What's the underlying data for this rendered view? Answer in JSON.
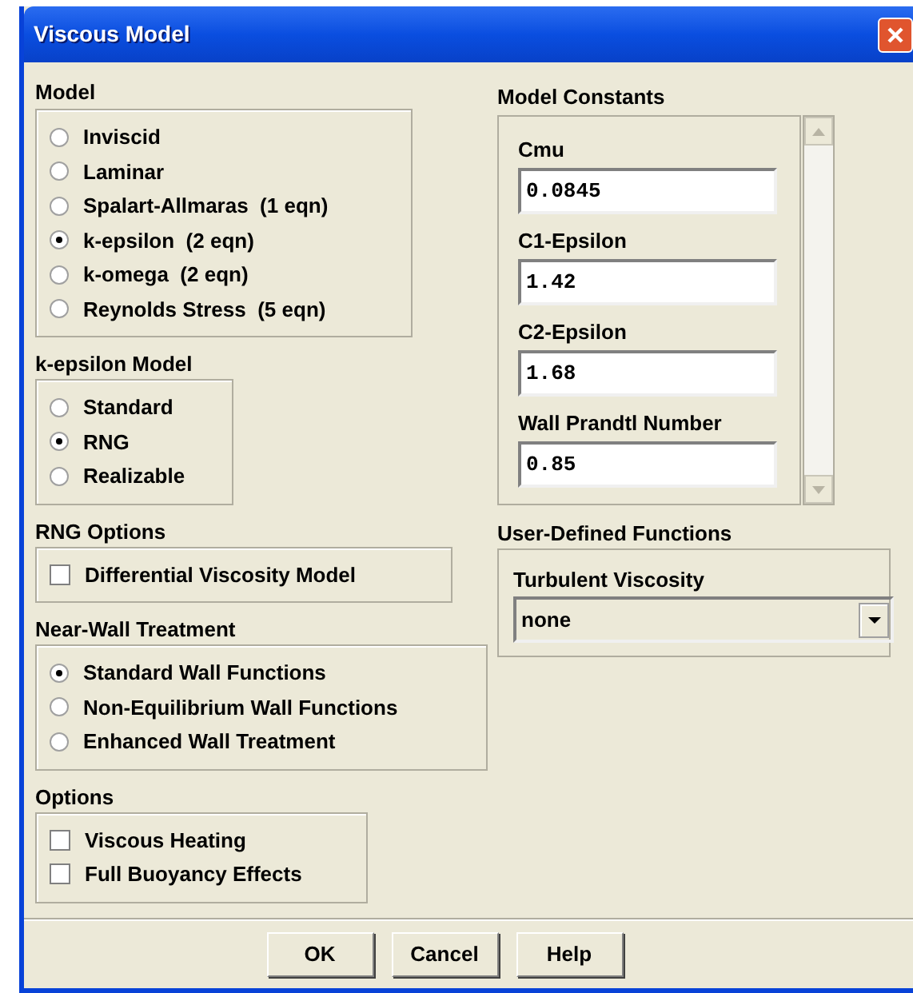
{
  "window": {
    "title": "Viscous Model"
  },
  "model": {
    "title": "Model",
    "options": [
      {
        "label": "Inviscid",
        "selected": false
      },
      {
        "label": "Laminar",
        "selected": false
      },
      {
        "label": "Spalart-Allmaras  (1 eqn)",
        "selected": false
      },
      {
        "label": "k-epsilon  (2 eqn)",
        "selected": true
      },
      {
        "label": "k-omega  (2 eqn)",
        "selected": false
      },
      {
        "label": "Reynolds Stress  (5 eqn)",
        "selected": false
      }
    ]
  },
  "k_epsilon_model": {
    "title": "k-epsilon Model",
    "options": [
      {
        "label": "Standard",
        "selected": false
      },
      {
        "label": "RNG",
        "selected": true
      },
      {
        "label": "Realizable",
        "selected": false
      }
    ]
  },
  "rng_options": {
    "title": "RNG Options",
    "checkboxes": [
      {
        "label": "Differential Viscosity Model",
        "checked": false
      }
    ]
  },
  "near_wall_treatment": {
    "title": "Near-Wall Treatment",
    "options": [
      {
        "label": "Standard Wall Functions",
        "selected": true
      },
      {
        "label": "Non-Equilibrium Wall Functions",
        "selected": false
      },
      {
        "label": "Enhanced Wall Treatment",
        "selected": false
      }
    ]
  },
  "options": {
    "title": "Options",
    "checkboxes": [
      {
        "label": "Viscous Heating",
        "checked": false
      },
      {
        "label": "Full Buoyancy Effects",
        "checked": false
      }
    ]
  },
  "model_constants": {
    "title": "Model Constants",
    "fields": [
      {
        "label": "Cmu",
        "value": "0.0845"
      },
      {
        "label": "C1-Epsilon",
        "value": "1.42"
      },
      {
        "label": "C2-Epsilon",
        "value": "1.68"
      },
      {
        "label": "Wall Prandtl Number",
        "value": "0.85"
      }
    ]
  },
  "user_defined_functions": {
    "title": "User-Defined Functions",
    "field_label": "Turbulent Viscosity",
    "value": "none"
  },
  "buttons": [
    "OK",
    "Cancel",
    "Help"
  ]
}
